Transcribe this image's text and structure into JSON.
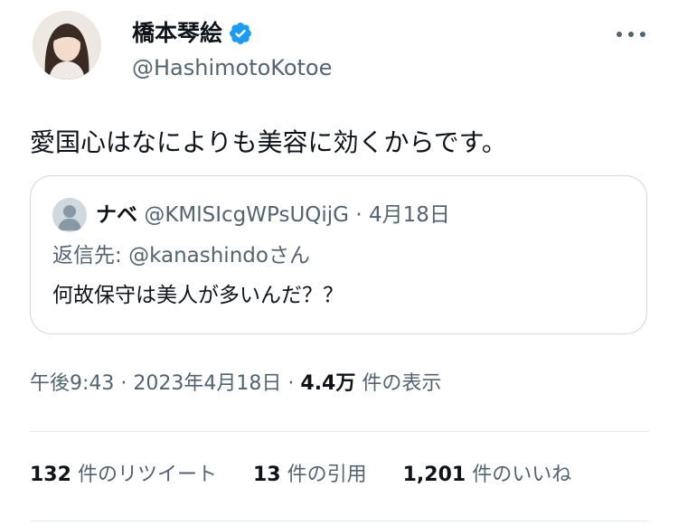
{
  "author": {
    "name": "橋本琴絵",
    "handle": "@HashimotoKotoe",
    "verified": true
  },
  "tweet": {
    "text": "愛国心はなによりも美容に効くからです。"
  },
  "quoted_tweet": {
    "name": "ナベ",
    "handle": "@KMlSIcgWPsUQijG",
    "separator": "·",
    "date": "4月18日",
    "reply_prefix": "返信先:",
    "reply_to": "@kanashindo",
    "reply_suffix": "さん",
    "text": "何故保守は美人が多いんだ？？"
  },
  "meta": {
    "time": "午後9:43",
    "sep1": "·",
    "date": "2023年4月18日",
    "sep2": "·",
    "views": "4.4万",
    "views_label": "件の表示"
  },
  "stats": {
    "retweets": {
      "count": "132",
      "label": "件のリツイート"
    },
    "quotes": {
      "count": "13",
      "label": "件の引用"
    },
    "likes": {
      "count": "1,201",
      "label": "件のいいね"
    }
  },
  "colors": {
    "verified_badge": "#1d9bf0",
    "secondary_text": "#536471",
    "border": "#cfd9de"
  }
}
